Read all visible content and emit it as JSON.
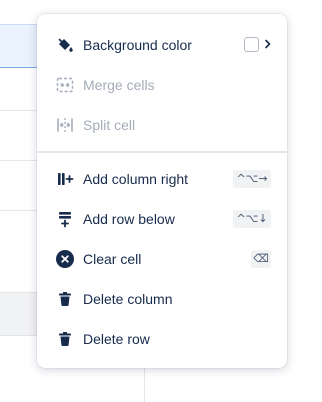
{
  "menu": {
    "items": [
      {
        "label": "Background color",
        "icon": "paint-bucket-icon",
        "disabled": false
      },
      {
        "label": "Merge cells",
        "icon": "merge-cells-icon",
        "disabled": true
      },
      {
        "label": "Split cell",
        "icon": "split-cell-icon",
        "disabled": true
      },
      {
        "label": "Add column right",
        "icon": "add-column-right-icon",
        "shortcut": "^⌥→",
        "disabled": false
      },
      {
        "label": "Add row below",
        "icon": "add-row-below-icon",
        "shortcut": "^⌥↓",
        "disabled": false
      },
      {
        "label": "Clear cell",
        "icon": "clear-cell-icon",
        "shortcut": "⌫",
        "disabled": false
      },
      {
        "label": "Delete column",
        "icon": "trash-icon",
        "disabled": false
      },
      {
        "label": "Delete row",
        "icon": "trash-icon",
        "disabled": false
      }
    ]
  },
  "colors": {
    "text": "#172b4d",
    "disabled_text": "#a5adba",
    "selection_bg": "#eaf2fd",
    "selection_border": "#7aa8e8"
  }
}
